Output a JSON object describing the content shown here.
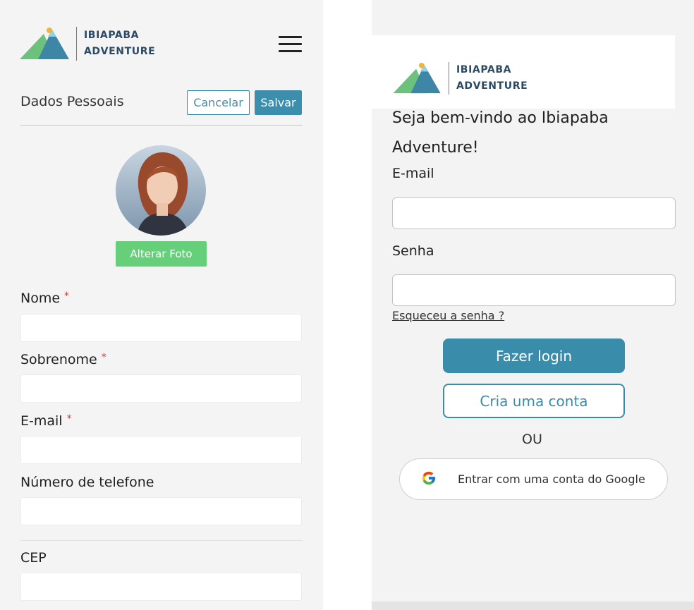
{
  "brand": {
    "line1": "IBIAPABA",
    "line2": "ADVENTURE"
  },
  "profile": {
    "title": "Dados Pessoais",
    "cancel_label": "Cancelar",
    "save_label": "Salvar",
    "change_photo_label": "Alterar Foto",
    "required_mark": "*",
    "fields": [
      {
        "label": "Nome",
        "required": true
      },
      {
        "label": "Sobrenome",
        "required": true
      },
      {
        "label": "E-mail",
        "required": true
      },
      {
        "label": "Número de telefone",
        "required": false
      },
      {
        "label": "CEP",
        "required": false
      }
    ]
  },
  "login": {
    "welcome": "Seja bem-vindo ao Ibiapaba Adventure!",
    "email_label": "E-mail",
    "password_label": "Senha",
    "forgot_label": "Esqueceu a senha ?",
    "login_label": "Fazer login",
    "create_label": "Cria uma conta",
    "or_label": "OU",
    "google_label": "Entrar com uma conta do Google"
  },
  "icons": {
    "logo": "mountain-logo-icon",
    "menu": "hamburger-menu-icon",
    "google": "google-g-icon"
  },
  "colors": {
    "primary": "#3c8fac",
    "photo_button": "#66cf79",
    "brand_text": "#2d4a63",
    "required": "#d03a3a"
  }
}
